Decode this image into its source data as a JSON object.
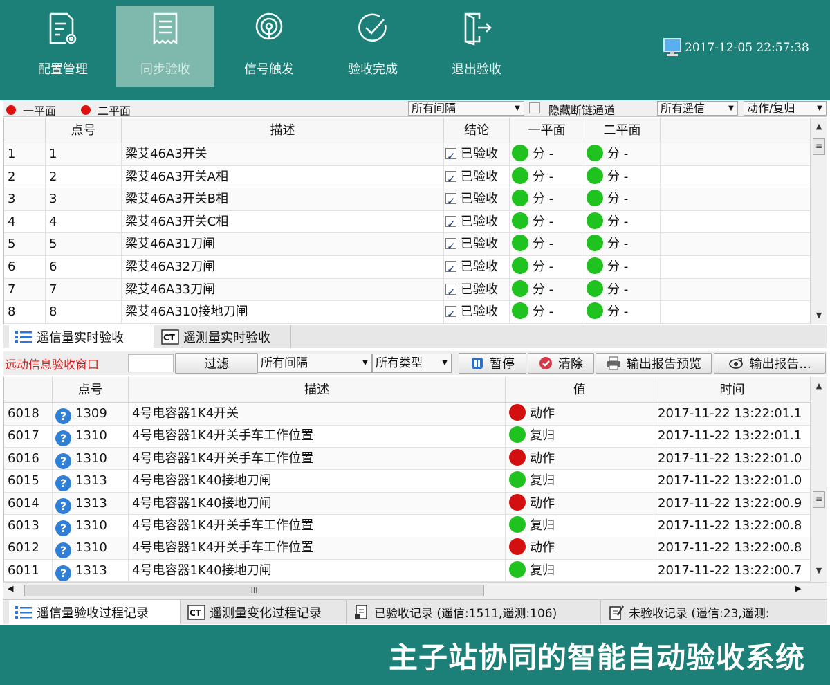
{
  "toolbar": {
    "items": [
      {
        "label": "配置管理",
        "icon": "config-doc-icon"
      },
      {
        "label": "同步验收",
        "icon": "receipt-icon"
      },
      {
        "label": "信号触发",
        "icon": "signal-icon"
      },
      {
        "label": "验收完成",
        "icon": "check-circle-icon"
      },
      {
        "label": "退出验收",
        "icon": "exit-door-icon"
      }
    ],
    "active_index": 1,
    "datetime": "2017-12-05 22:57:38"
  },
  "filters_top": {
    "legend_1": "一平面",
    "legend_2": "二平面",
    "interval_select": "所有间隔",
    "hide_broken_label": "隐藏断链通道",
    "telesignal_select": "所有遥信",
    "action_select": "动作/复归"
  },
  "table1": {
    "headers": [
      "点号",
      "描述",
      "结论",
      "一平面",
      "二平面"
    ],
    "rows": [
      {
        "idx": "1",
        "point": "1",
        "desc": "梁艾46A3开关",
        "result": "已验收",
        "p1": "分 -",
        "p2": "分 -"
      },
      {
        "idx": "2",
        "point": "2",
        "desc": "梁艾46A3开关A相",
        "result": "已验收",
        "p1": "分 -",
        "p2": "分 -"
      },
      {
        "idx": "3",
        "point": "3",
        "desc": "梁艾46A3开关B相",
        "result": "已验收",
        "p1": "分 -",
        "p2": "分 -"
      },
      {
        "idx": "4",
        "point": "4",
        "desc": "梁艾46A3开关C相",
        "result": "已验收",
        "p1": "分 -",
        "p2": "分 -"
      },
      {
        "idx": "5",
        "point": "5",
        "desc": "梁艾46A31刀闸",
        "result": "已验收",
        "p1": "分 -",
        "p2": "分 -"
      },
      {
        "idx": "6",
        "point": "6",
        "desc": "梁艾46A32刀闸",
        "result": "已验收",
        "p1": "分 -",
        "p2": "分 -"
      },
      {
        "idx": "7",
        "point": "7",
        "desc": "梁艾46A33刀闸",
        "result": "已验收",
        "p1": "分 -",
        "p2": "分 -"
      },
      {
        "idx": "8",
        "point": "8",
        "desc": "梁艾46A310接地刀闸",
        "result": "已验收",
        "p1": "分 -",
        "p2": "分 -"
      }
    ]
  },
  "tabs_mid": [
    "遥信量实时验收",
    "遥测量实时验收"
  ],
  "toolbar2": {
    "window_label": "远动信息验收窗口",
    "filter_input": "",
    "filter_button": "过滤",
    "interval_select": "所有间隔",
    "type_select": "所有类型",
    "pause": "暂停",
    "clear": "清除",
    "preview": "输出报告预览",
    "export": "输出报告..."
  },
  "table2": {
    "headers": [
      "点号",
      "描述",
      "值",
      "时间"
    ],
    "rows": [
      {
        "idx": "6018",
        "point": "1309",
        "desc": "4号电容器1K4开关",
        "value": "动作",
        "state": "red",
        "time": "2017-11-22 13:22:01.1"
      },
      {
        "idx": "6017",
        "point": "1310",
        "desc": "4号电容器1K4开关手车工作位置",
        "value": "复归",
        "state": "green",
        "time": "2017-11-22 13:22:01.1"
      },
      {
        "idx": "6016",
        "point": "1310",
        "desc": "4号电容器1K4开关手车工作位置",
        "value": "动作",
        "state": "red",
        "time": "2017-11-22 13:22:01.0"
      },
      {
        "idx": "6015",
        "point": "1313",
        "desc": "4号电容器1K40接地刀闸",
        "value": "复归",
        "state": "green",
        "time": "2017-11-22 13:22:01.0"
      },
      {
        "idx": "6014",
        "point": "1313",
        "desc": "4号电容器1K40接地刀闸",
        "value": "动作",
        "state": "red",
        "time": "2017-11-22 13:22:00.9"
      },
      {
        "idx": "6013",
        "point": "1310",
        "desc": "4号电容器1K4开关手车工作位置",
        "value": "复归",
        "state": "green",
        "time": "2017-11-22 13:22:00.8"
      },
      {
        "idx": "6012",
        "point": "1310",
        "desc": "4号电容器1K4开关手车工作位置",
        "value": "动作",
        "state": "red",
        "time": "2017-11-22 13:22:00.8"
      },
      {
        "idx": "6011",
        "point": "1313",
        "desc": "4号电容器1K40接地刀闸",
        "value": "复归",
        "state": "green",
        "time": "2017-11-22 13:22:00.7"
      }
    ]
  },
  "tabs_bottom": [
    "遥信量验收过程记录",
    "遥测量变化过程记录",
    "已验收记录 (遥信:1511,遥测:106)",
    "未验收记录 (遥信:23,遥测:"
  ],
  "footer_title": "主子站协同的智能自动验收系统",
  "colors": {
    "brand": "#1c8078",
    "ok_dot": "#1fc21f",
    "action_dot": "#d40f0f",
    "window_label": "#d22020"
  }
}
